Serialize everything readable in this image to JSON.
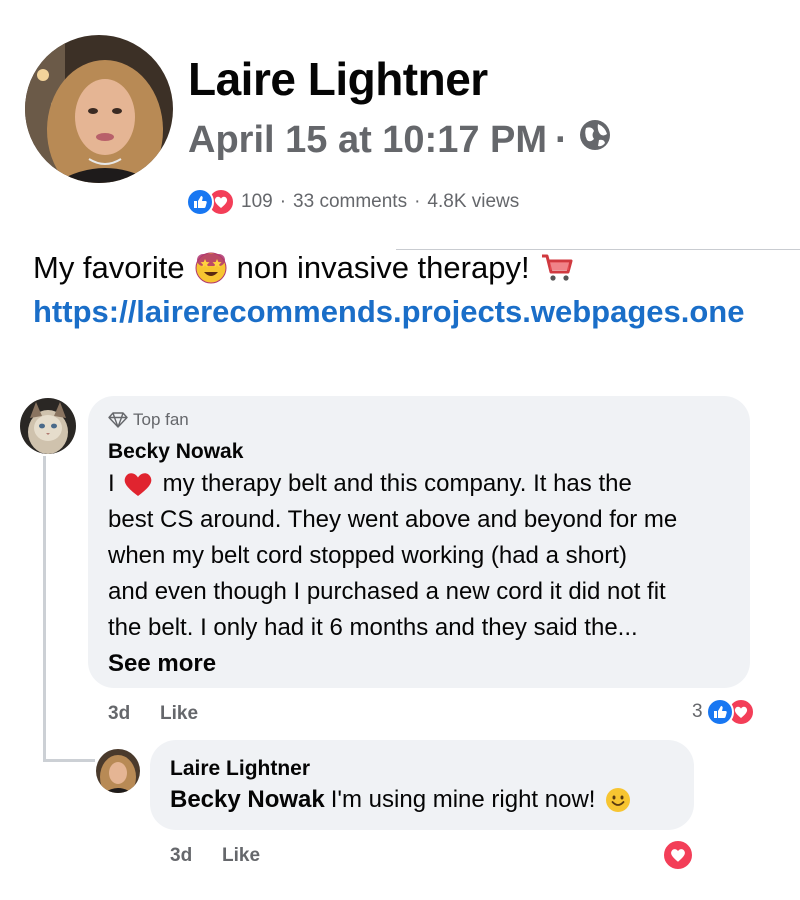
{
  "post": {
    "author": "Laire Lightner",
    "timestamp": "April 15 at 10:17 PM",
    "separator": "·",
    "privacy_icon": "globe-icon",
    "reactions_count": "109",
    "comments_count": "33 comments",
    "views_count": "4.8K views",
    "text_before_emoji": "My favorite",
    "emoji_1": "star-struck-emoji",
    "text_after_emoji": "non invasive therapy!",
    "emoji_2": "shopping-cart-emoji",
    "link": "https://lairerecommends.projects.webpages.one"
  },
  "comments": [
    {
      "badge_icon": "diamond-icon",
      "badge": "Top fan",
      "author": "Becky Nowak",
      "lines": {
        "l1_pre": "I",
        "l1_post": "my therapy belt and this company. It has the",
        "l2": "best CS around. They went above and beyond for me",
        "l3": "when my belt cord stopped working (had a short)",
        "l4": "and even though I purchased a new cord it did not fit",
        "l5": "the belt. I only had it 6 months and they said the..."
      },
      "see_more": "See more",
      "age": "3d",
      "like_label": "Like",
      "reaction_count": "3"
    }
  ],
  "reply": {
    "author": "Laire Lightner",
    "mention": "Becky Nowak",
    "text": "I'm using mine right now!",
    "emoji": "smiling-face-emoji",
    "age": "3d",
    "like_label": "Like"
  },
  "colors": {
    "like_blue": "#1877f2",
    "love_red": "#f33e58",
    "link_blue": "#1a6ec8",
    "secondary_text": "#65676b",
    "bubble_bg": "#f0f2f5"
  }
}
